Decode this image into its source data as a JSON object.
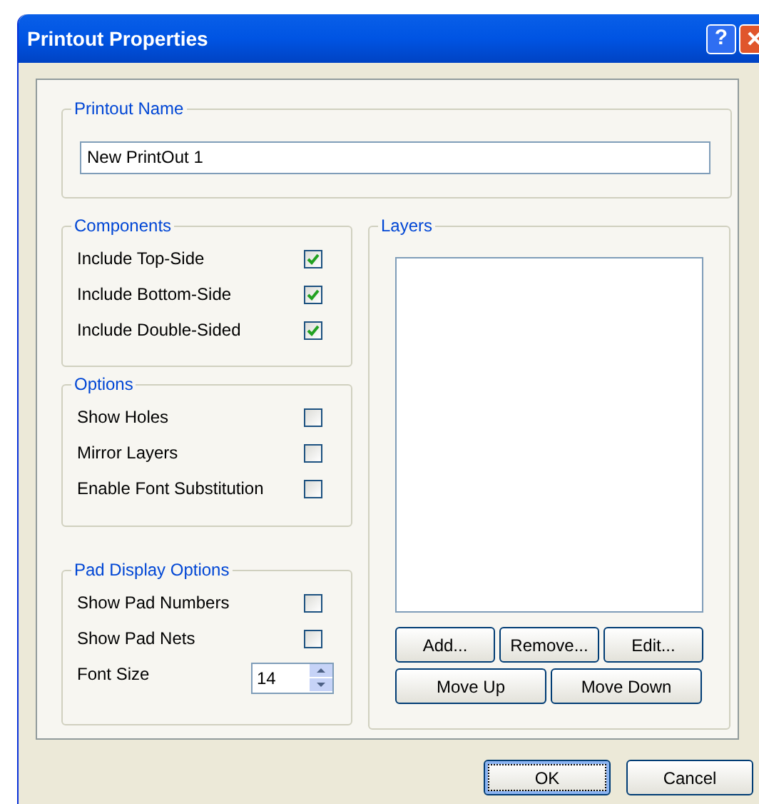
{
  "window": {
    "title": "Printout Properties",
    "help_button": "?"
  },
  "printout_name": {
    "label": "Printout Name",
    "value": "New PrintOut 1"
  },
  "groups": [
    {
      "title": "Components",
      "rows": [
        {
          "kind": "checkbox",
          "label": "Include Top-Side",
          "checked": true
        },
        {
          "kind": "checkbox",
          "label": "Include Bottom-Side",
          "checked": true
        },
        {
          "kind": "checkbox",
          "label": "Include Double-Sided",
          "checked": true
        }
      ]
    },
    {
      "title": "Options",
      "rows": [
        {
          "kind": "checkbox",
          "label": "Show Holes",
          "checked": false
        },
        {
          "kind": "checkbox",
          "label": "Mirror Layers",
          "checked": false
        },
        {
          "kind": "checkbox",
          "label": "Enable Font Substitution",
          "checked": false
        }
      ]
    },
    {
      "title": "Pad Display Options",
      "rows": [
        {
          "kind": "checkbox",
          "label": "Show Pad Numbers",
          "checked": false
        },
        {
          "kind": "checkbox",
          "label": "Show Pad Nets",
          "checked": false
        },
        {
          "kind": "spinner",
          "label": "Font Size",
          "value": "14"
        }
      ]
    }
  ],
  "layers": {
    "title": "Layers",
    "buttons_row_1": [
      "Add...",
      "Remove...",
      "Edit..."
    ],
    "buttons_row_2": [
      "Move Up",
      "Move Down"
    ]
  },
  "buttons": [
    {
      "label": "OK",
      "default": true
    },
    {
      "label": "Cancel",
      "default": false
    }
  ]
}
